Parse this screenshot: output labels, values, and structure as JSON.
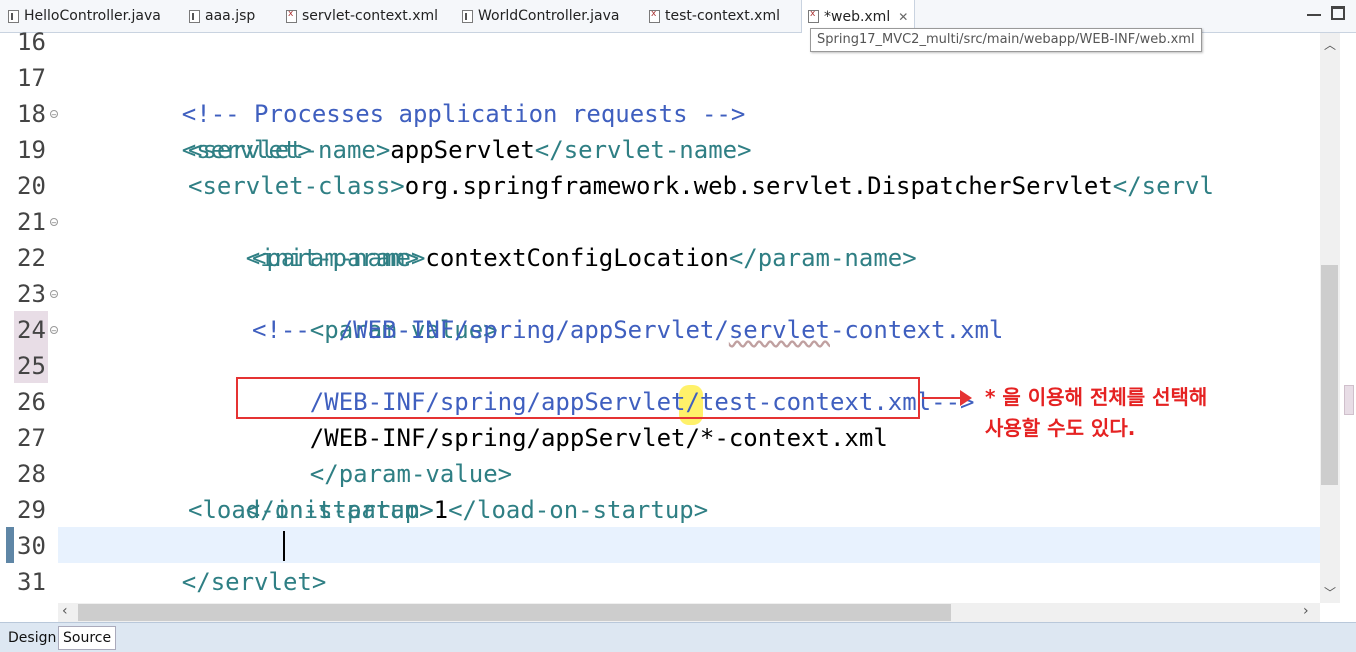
{
  "tabs": [
    {
      "label": "HelloController.java",
      "icon": "java-file-icon"
    },
    {
      "label": "aaa.jsp",
      "icon": "jsp-file-icon"
    },
    {
      "label": "servlet-context.xml",
      "icon": "xml-file-icon"
    },
    {
      "label": "WorldController.java",
      "icon": "java-file-icon"
    },
    {
      "label": "test-context.xml",
      "icon": "xml-file-icon"
    },
    {
      "label": "*web.xml",
      "icon": "xml-file-icon",
      "active": true
    }
  ],
  "tooltip": "Spring17_MVC2_multi/src/main/webapp/WEB-INF/web.xml",
  "editor": {
    "line_numbers": [
      "16",
      "17",
      "18",
      "19",
      "20",
      "21",
      "22",
      "23",
      "24",
      "25",
      "26",
      "27",
      "28",
      "29",
      "30",
      "31"
    ],
    "lines": {
      "l17": {
        "c1": "<!-- Processes application requests -->"
      },
      "l18": {
        "t1": "<servlet>"
      },
      "l19": {
        "t1": "<servlet-name>",
        "x1": "appServlet",
        "t2": "</servlet-name>"
      },
      "l20": {
        "t1": "<servlet-class>",
        "x1": "org.springframework.web.servlet.DispatcherServlet",
        "t2": "</servl"
      },
      "l21": {
        "t1": "<init-param>"
      },
      "l22": {
        "t1": "<param-name>",
        "x1": "contextConfigLocation",
        "t2": "</param-name>"
      },
      "l23": {
        "t1": "<param-value>"
      },
      "l24": {
        "c1": "<!--  /WEB-INF/spring/appServlet/",
        "c2": "servlet",
        "c3": "-context.xml"
      },
      "l25": {
        "c1": "/WEB-INF/spring/appServlet/test-context.xml-->"
      },
      "l26": {
        "x1": "/WEB-INF/spring/appServlet/*-context.xml"
      },
      "l27": {
        "t1": "</param-value>"
      },
      "l28": {
        "t1": "</init-param>"
      },
      "l29": {
        "t1": "<load-on-startup>",
        "x1": "1",
        "t2": "</load-on-startup>"
      },
      "l30": {
        "t1": "</servlet>"
      }
    }
  },
  "annotation": {
    "line1": "* 을 이용해 전체를 선택해",
    "line2": "사용할 수도 있다."
  },
  "bottom_tabs": {
    "design": "Design",
    "source": "Source"
  },
  "colors": {
    "tag": "#2f7f84",
    "comment": "#3f5fbf",
    "text": "#000000",
    "annotation_red": "#e53333",
    "star_highlight": "#fff16a",
    "current_line": "#e8f2fe"
  }
}
